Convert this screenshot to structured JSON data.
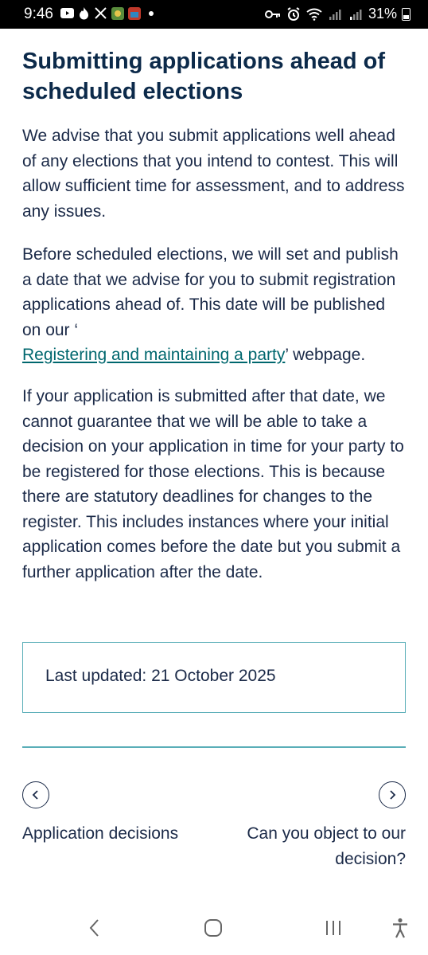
{
  "status_bar": {
    "time": "9:46",
    "battery_percent": "31%",
    "left_icons": [
      "youtube-icon",
      "fire-icon",
      "x-icon",
      "app-icon-1",
      "app-icon-2",
      "dot-icon"
    ],
    "right_icons": [
      "key-icon",
      "alarm-icon",
      "wifi-icon",
      "signal-icon",
      "signal-icon",
      "battery-icon"
    ]
  },
  "article": {
    "heading": "Submitting applications ahead of scheduled elections",
    "p1": "We advise that you submit applications well ahead of any elections that you intend to contest. This will allow sufficient time for assessment, and to address any issues.",
    "p2_before": "Before scheduled elections, we will set and publish a date that we advise for you to submit registration applications ahead of. This date will be published on our ‘",
    "p2_link": "Registering and maintaining a party",
    "p2_after": "’ webpage.",
    "p3": "If your application is submitted after that date, we cannot guarantee that we will be able to take a decision on your application in time for your party to be registered for those elections. This is because there are statutory deadlines for changes to the register. This includes instances where your initial application comes before the date but you submit a further application after the date."
  },
  "last_updated": "Last updated: 21 October 2025",
  "pager": {
    "prev_label": "Application decisions",
    "next_label": "Can you object to our decision?"
  },
  "colors": {
    "heading": "#0c2a4a",
    "body_text": "#1b2a48",
    "link": "#00676e",
    "border": "#5aaeb8"
  }
}
